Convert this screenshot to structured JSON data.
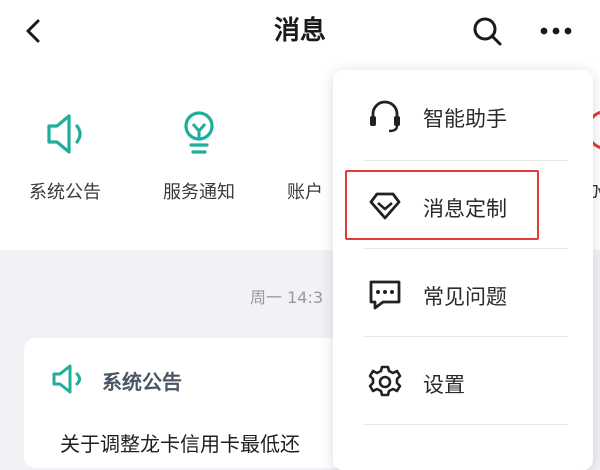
{
  "header": {
    "title": "消息",
    "icons": {
      "back": "back-arrow-icon",
      "search": "search-icon",
      "more": "more-dots-icon"
    }
  },
  "categories": [
    {
      "label": "系统公告",
      "icon": "speaker-icon"
    },
    {
      "label": "服务通知",
      "icon": "lightbulb-icon"
    },
    {
      "label": "账户",
      "icon": "user-icon"
    }
  ],
  "edge_fragment_text": "办",
  "timestamp": "周一 14:3",
  "message_card": {
    "icon": "speaker-icon",
    "title": "系统公告",
    "body": "关于调整龙卡信用卡最低还"
  },
  "dropdown_menu": {
    "items": [
      {
        "label": "智能助手",
        "icon": "headset-icon"
      },
      {
        "label": "消息定制",
        "icon": "diamond-icon",
        "highlighted": true
      },
      {
        "label": "常见问题",
        "icon": "chat-bubble-icon"
      },
      {
        "label": "设置",
        "icon": "gear-icon"
      }
    ]
  },
  "colors": {
    "accent_teal": "#1fae9a",
    "user_blue": "#2f74d6",
    "highlight_red": "#e03a3a",
    "background": "#f2f2f6"
  }
}
